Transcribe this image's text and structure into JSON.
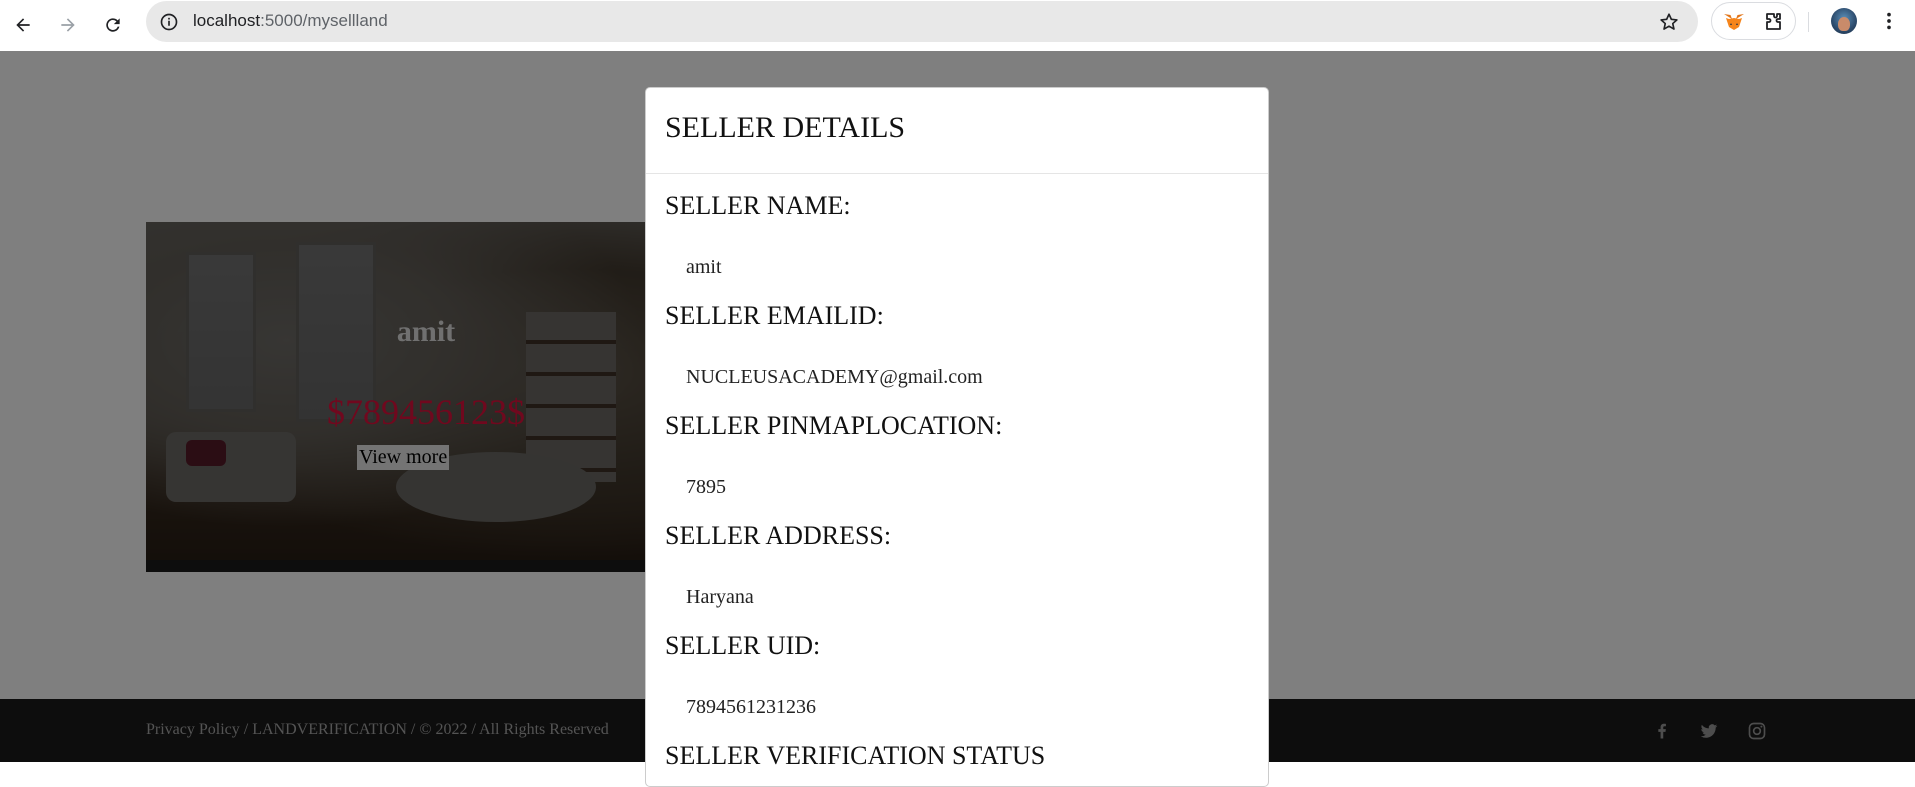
{
  "browser": {
    "url_host": "localhost",
    "url_path": ":5000/mysellland"
  },
  "card": {
    "name": "amit",
    "price": "$789456123$",
    "view_more_label": "View more"
  },
  "footer": {
    "text": "Privacy Policy / LANDVERIFICATION / © 2022 / All Rights Reserved",
    "social_icons": [
      "facebook-icon",
      "twitter-icon",
      "instagram-icon"
    ]
  },
  "modal": {
    "title": "SELLER DETAILS",
    "fields": [
      {
        "label": "SELLER NAME:",
        "value": "amit"
      },
      {
        "label": "SELLER EMAILID:",
        "value": "NUCLEUSACADEMY@gmail.com"
      },
      {
        "label": "SELLER PINMAPLOCATION:",
        "value": "7895"
      },
      {
        "label": "SELLER ADDRESS:",
        "value": "Haryana"
      },
      {
        "label": "SELLER UID:",
        "value": "7894561231236"
      },
      {
        "label": "SELLER VERIFICATION STATUS"
      }
    ]
  },
  "colors": {
    "price": "#e0103c",
    "footer_bg": "#1a1a1a",
    "backdrop": "rgba(0,0,0,0.5)"
  }
}
